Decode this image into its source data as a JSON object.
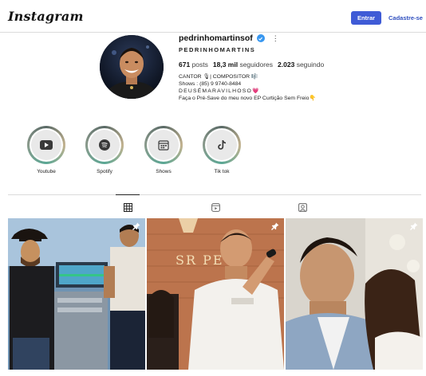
{
  "header": {
    "logo_text": "Instagram",
    "login_label": "Entrar",
    "signup_label": "Cadastre-se",
    "accent": "#3f5bd6"
  },
  "profile": {
    "username": "pedrinhomartinsof",
    "full_name": "PEDRINHOMARTINS",
    "posts_count": "671",
    "posts_label": "posts",
    "followers_count": "18,3 mil",
    "followers_label": "seguidores",
    "following_count": "2.023",
    "following_label": "seguindo",
    "bio_lines": [
      "CANTOR 🎙| COMPOSITOR 🎼",
      "Shows : (85) 9 9740-8484",
      "DEUSÉMARAVILHOSO💗",
      "Faça o Pré-Save do meu novo EP Curtição Sem Freio👇"
    ]
  },
  "highlights": [
    {
      "label": "Youtube",
      "icon": "youtube-icon"
    },
    {
      "label": "Spotify",
      "icon": "spotify-icon"
    },
    {
      "label": "Shows",
      "icon": "calendar-icon"
    },
    {
      "label": "Tik tok",
      "icon": "tiktok-icon"
    }
  ],
  "tabs": [
    {
      "icon": "grid-icon",
      "active": true
    },
    {
      "icon": "reels-icon",
      "active": false
    },
    {
      "icon": "tagged-icon",
      "active": false
    }
  ],
  "posts": [
    {
      "description": "studio session",
      "pinned": true,
      "overlay_text": ""
    },
    {
      "description": "singing with microphone",
      "pinned": true,
      "overlay_text": "SR PE"
    },
    {
      "description": "couple forehead kiss",
      "pinned": true,
      "overlay_text": ""
    }
  ]
}
